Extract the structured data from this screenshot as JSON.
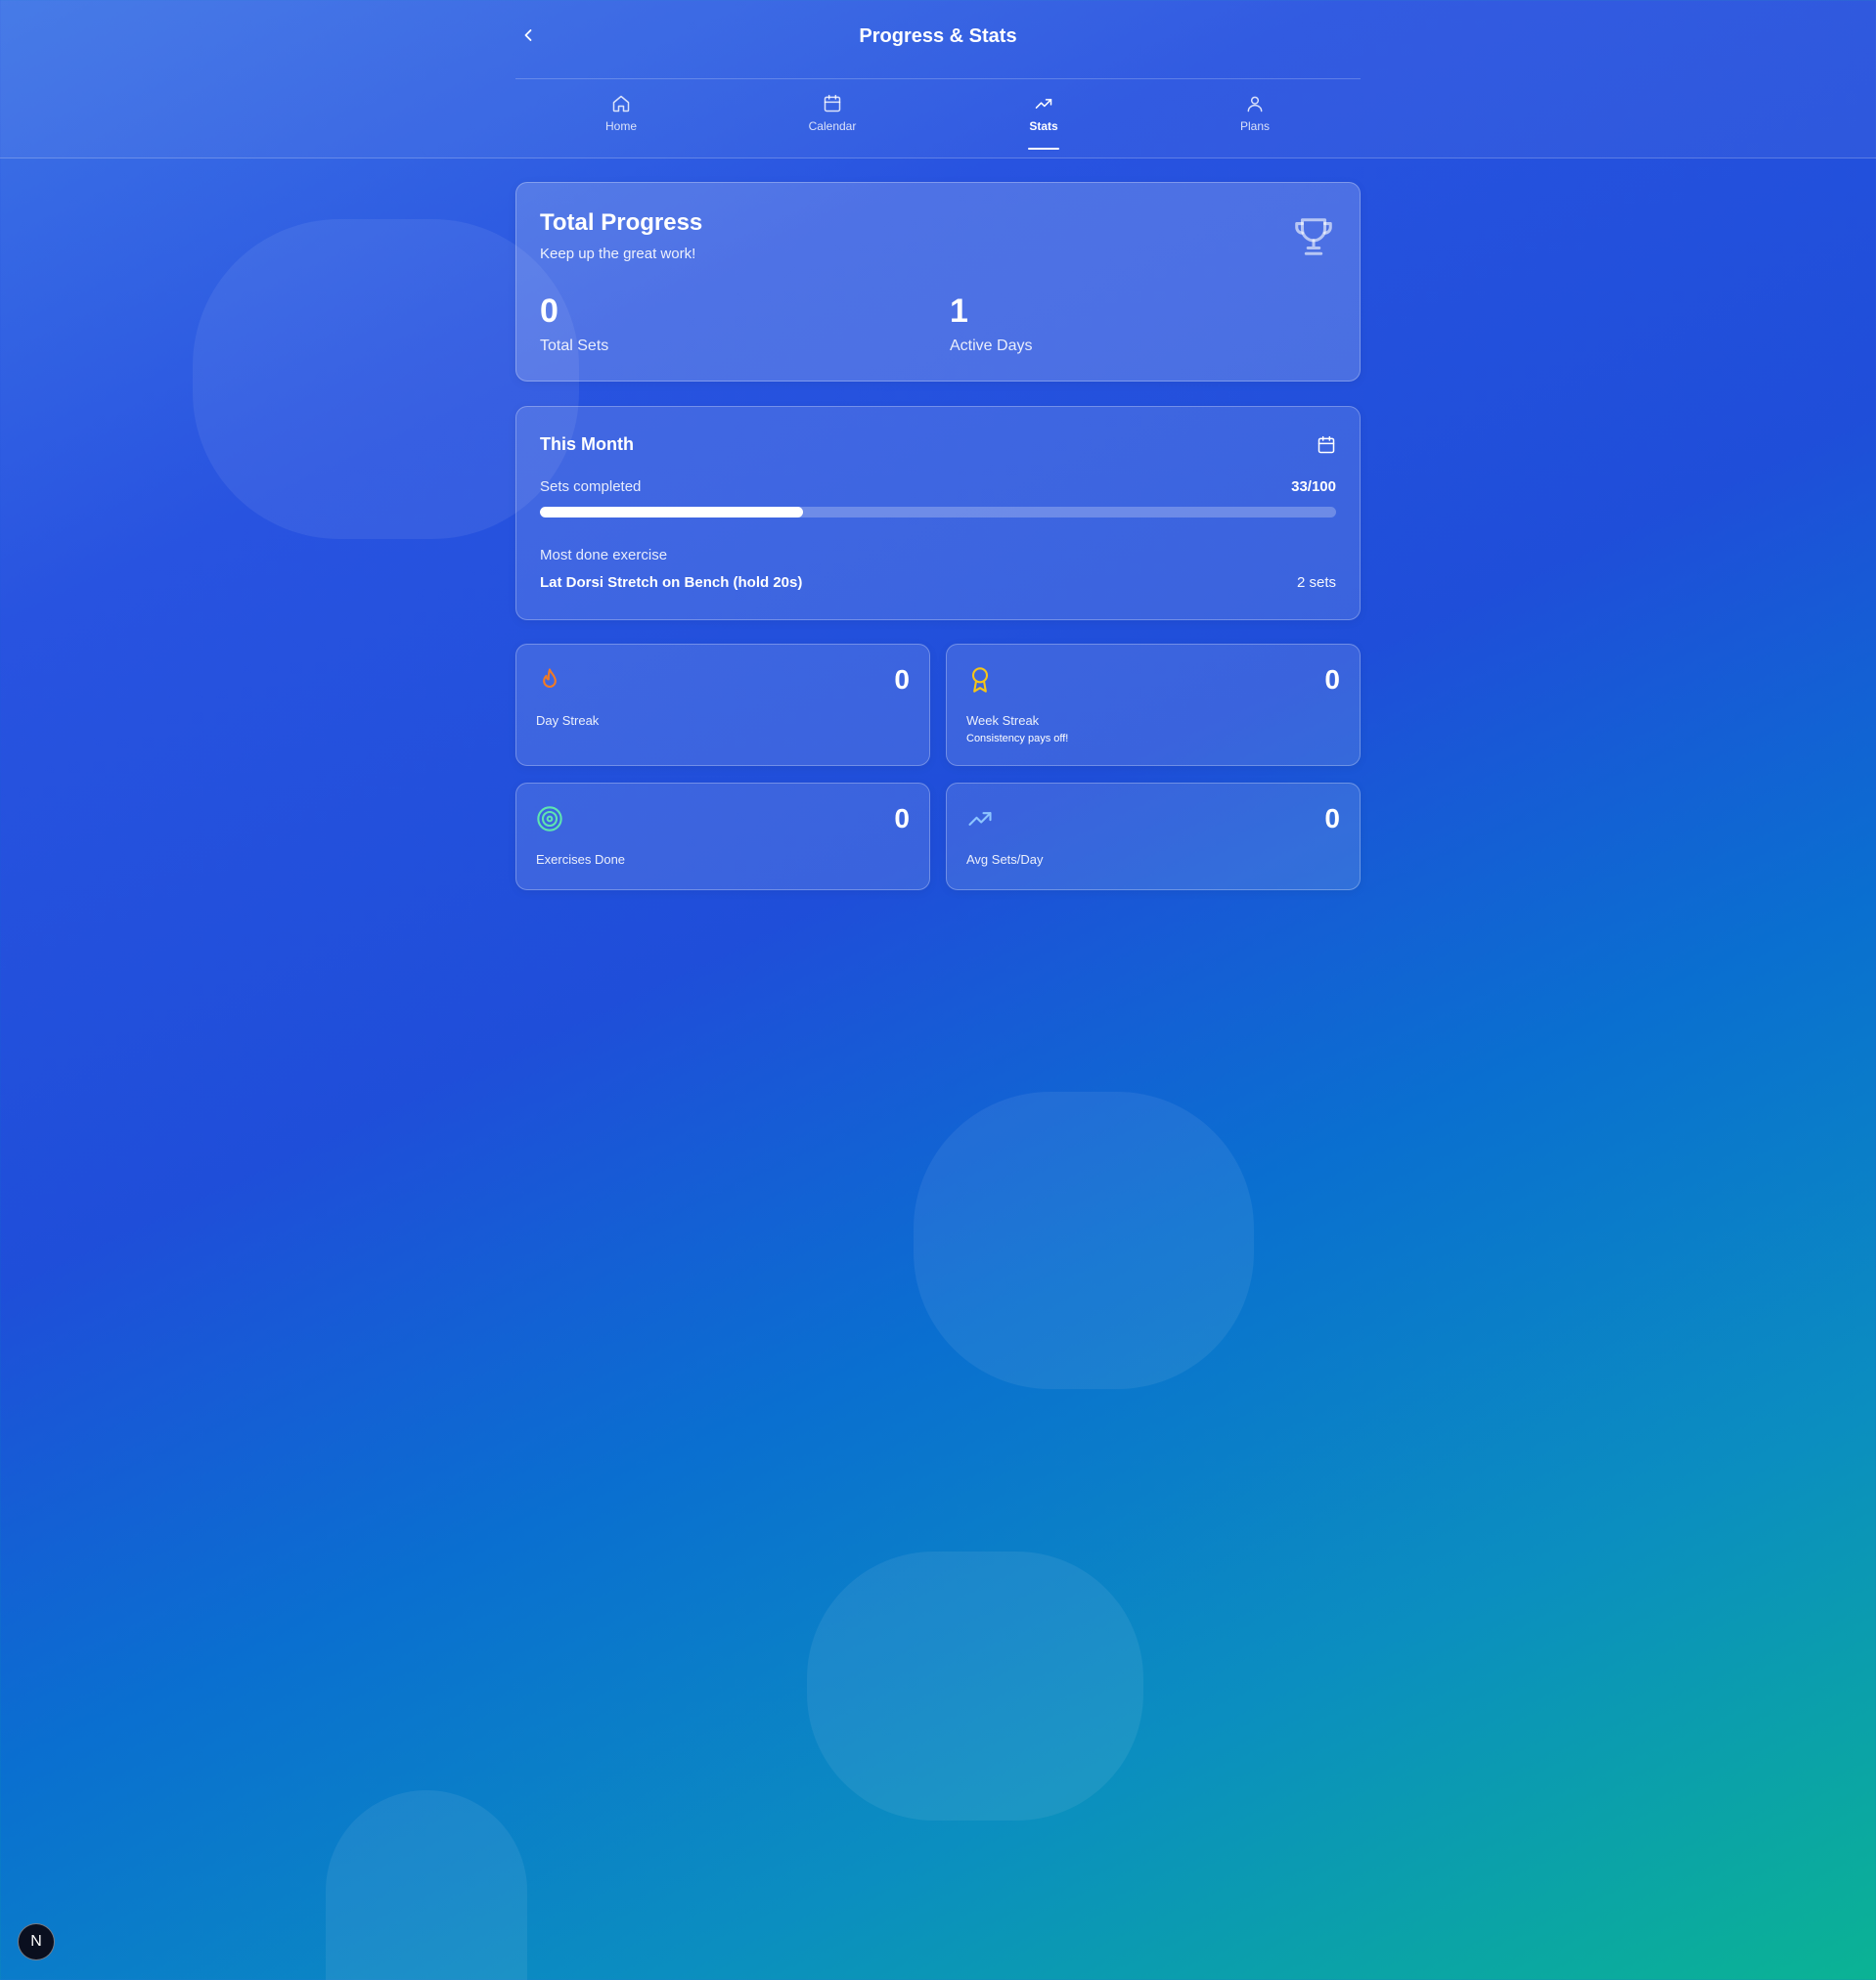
{
  "header": {
    "title": "Progress & Stats",
    "tabs": [
      {
        "label": "Home",
        "icon": "home-icon"
      },
      {
        "label": "Calendar",
        "icon": "calendar-icon"
      },
      {
        "label": "Stats",
        "icon": "trending-up-icon",
        "active": true
      },
      {
        "label": "Plans",
        "icon": "user-icon"
      }
    ]
  },
  "total_progress": {
    "title": "Total Progress",
    "subtitle": "Keep up the great work!",
    "icon": "trophy-icon",
    "total_sets_value": "0",
    "total_sets_label": "Total Sets",
    "active_days_value": "1",
    "active_days_label": "Active Days"
  },
  "this_month": {
    "title": "This Month",
    "icon": "calendar-icon",
    "sets_label": "Sets completed",
    "sets_value": "33/100",
    "progress_fraction": 0.33,
    "most_done_label": "Most done exercise",
    "exercise_name": "Lat Dorsi Stretch on Bench (hold 20s)",
    "exercise_sets": "2 sets"
  },
  "stat_cards": [
    {
      "label": "Day Streak",
      "value": "0",
      "icon": "flame-icon",
      "icon_color": "#f07a24"
    },
    {
      "label": "Week Streak",
      "value": "0",
      "subtext": "Consistency pays off!",
      "icon": "award-icon",
      "icon_color": "#f5c518"
    },
    {
      "label": "Exercises Done",
      "value": "0",
      "icon": "target-icon",
      "icon_color": "#5ee4b0"
    },
    {
      "label": "Avg Sets/Day",
      "value": "0",
      "icon": "trending-up-icon",
      "icon_color": "#8ec5ff"
    }
  ],
  "badge": {
    "letter": "N"
  }
}
